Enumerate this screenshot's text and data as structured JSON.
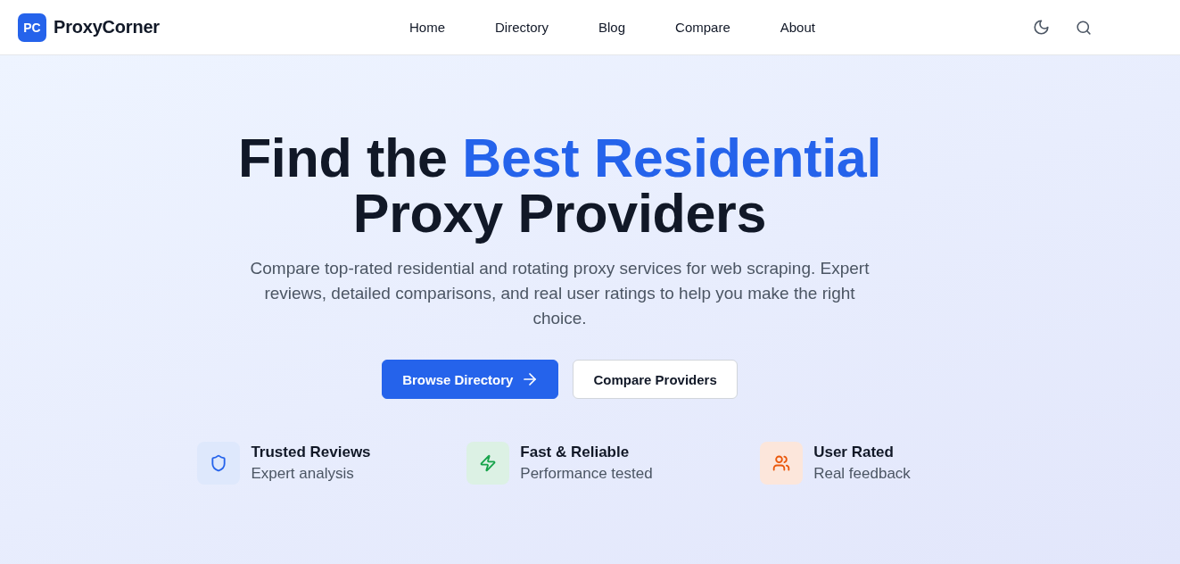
{
  "header": {
    "logo": {
      "mark": "PC",
      "name": "ProxyCorner"
    },
    "nav": [
      {
        "label": "Home"
      },
      {
        "label": "Directory"
      },
      {
        "label": "Blog"
      },
      {
        "label": "Compare"
      },
      {
        "label": "About"
      }
    ]
  },
  "hero": {
    "title_lines": [
      [
        {
          "text": "Find the ",
          "accent": false
        },
        {
          "text": "Best Residential",
          "accent": true
        }
      ],
      [
        {
          "text": "Proxy Providers",
          "accent": false
        }
      ]
    ],
    "subtitle": "Compare top-rated residential and rotating proxy services for web scraping. Expert reviews, detailed comparisons, and real user ratings to help you make the right choice.",
    "buttons": [
      {
        "label": "Browse Directory",
        "kind": "primary"
      },
      {
        "label": "Compare Providers",
        "kind": "secondary"
      }
    ],
    "features": [
      {
        "kind": "shield",
        "title": "Trusted Reviews",
        "subtitle": "Expert analysis",
        "color": "#2563eb"
      },
      {
        "kind": "bolt",
        "title": "Fast & Reliable",
        "subtitle": "Performance tested",
        "color": "#16a34a"
      },
      {
        "kind": "users",
        "title": "User Rated",
        "subtitle": "Real feedback",
        "color": "#ea580c"
      }
    ]
  }
}
